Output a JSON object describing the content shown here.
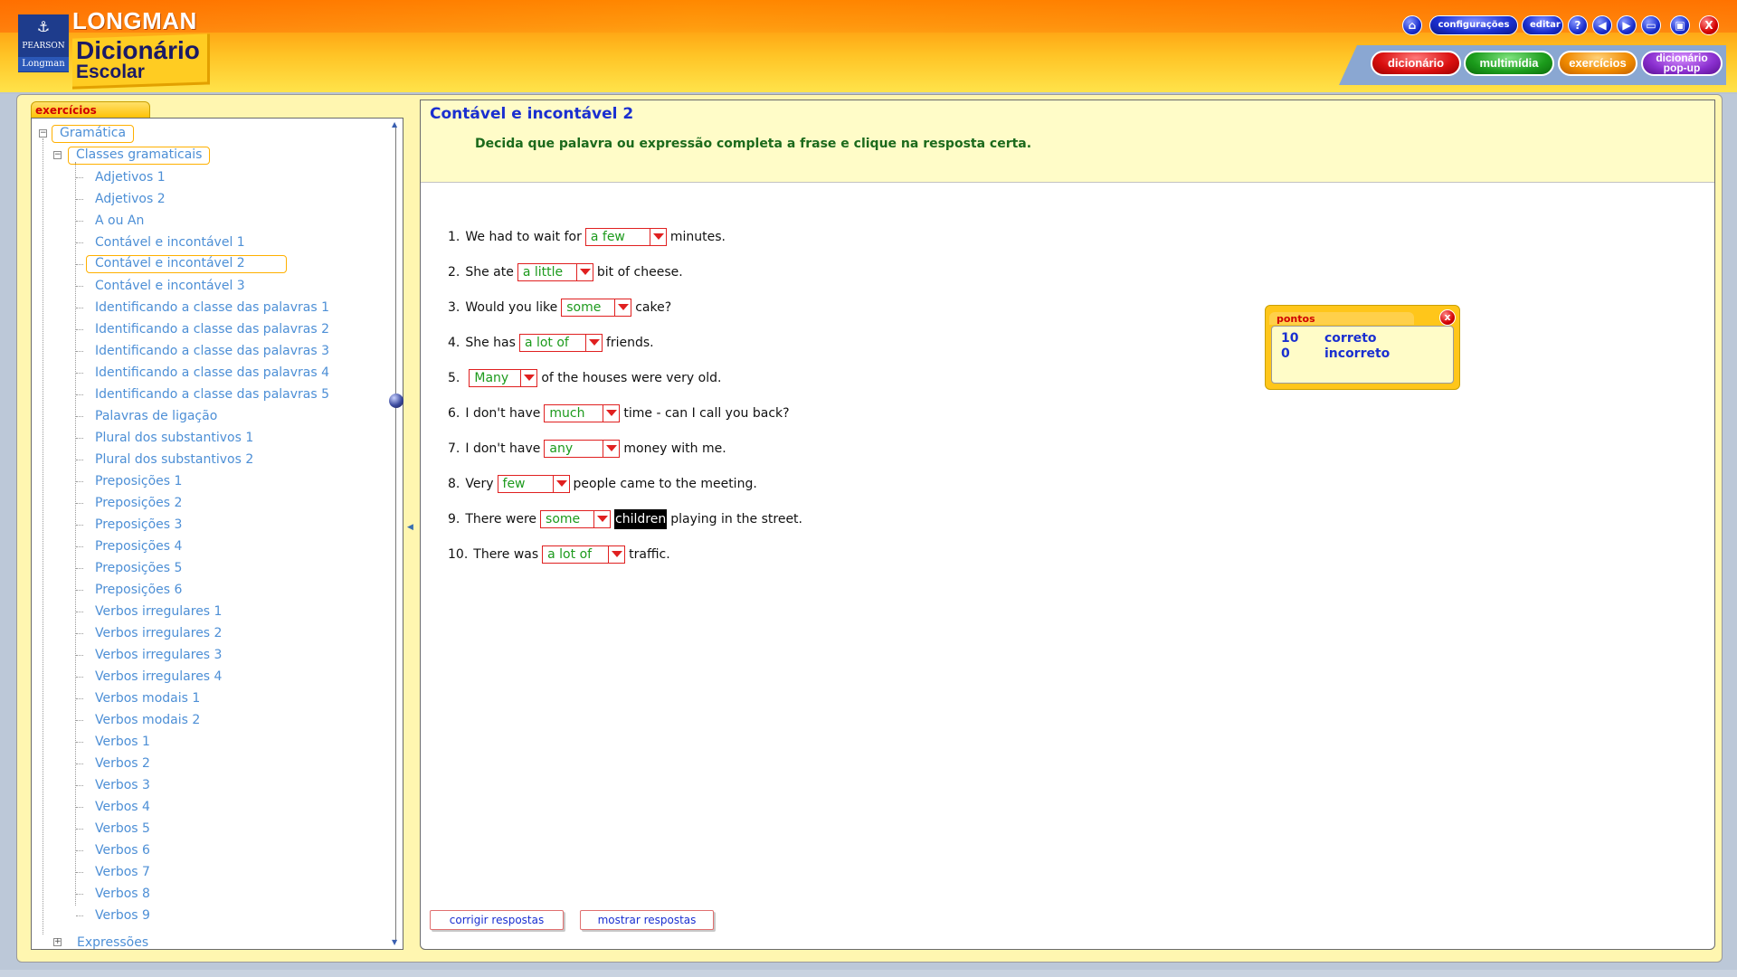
{
  "header": {
    "brand": "LONGMAN",
    "title_line1": "Dicionário",
    "title_line2": "Escolar",
    "publisher_top": "PEARSON",
    "publisher_bottom": "Longman"
  },
  "toolbar": {
    "home_icon": "home-icon",
    "settings_label": "configurações",
    "edit_label": "editar",
    "help_label": "?",
    "back_icon": "arrow-left-icon",
    "forward_icon": "arrow-right-icon",
    "restore_icon": "window-restore-icon",
    "maximize_icon": "window-maximize-icon",
    "close_label": "X"
  },
  "tabs": [
    {
      "label": "dicionário",
      "color": "#d90f0f"
    },
    {
      "label": "multimídia",
      "color": "#1c9c1c"
    },
    {
      "label": "exercícios",
      "color": "#f08a00"
    },
    {
      "label_line1": "dicionário",
      "label_line2": "pop-up",
      "color": "#8a2fcf"
    }
  ],
  "sidebar": {
    "tab_label": "exercícios",
    "root": "Gramática",
    "group": "Classes gramaticais",
    "items": [
      "Adjetivos 1",
      "Adjetivos 2",
      "A ou An",
      "Contável e incontável 1",
      "Contável e incontável 2",
      "Contável e incontável 3",
      "Identificando a classe das palavras 1",
      "Identificando a classe das palavras 2",
      "Identificando a classe das palavras 3",
      "Identificando a classe das palavras 4",
      "Identificando a classe das palavras 5",
      "Palavras de ligação",
      "Plural dos substantivos 1",
      "Plural dos substantivos 2",
      "Preposições 1",
      "Preposições 2",
      "Preposições 3",
      "Preposições 4",
      "Preposições 5",
      "Preposições 6",
      "Verbos irregulares 1",
      "Verbos irregulares 2",
      "Verbos irregulares 3",
      "Verbos irregulares 4",
      "Verbos modais 1",
      "Verbos modais 2",
      "Verbos 1",
      "Verbos 2",
      "Verbos 3",
      "Verbos 4",
      "Verbos 5",
      "Verbos 6",
      "Verbos 7",
      "Verbos 8",
      "Verbos 9"
    ],
    "selected_item": "Contável e incontável 2",
    "last_root": "Expressões"
  },
  "exercise": {
    "title": "Contável e incontável 2",
    "instructions": "Decida que palavra ou expressão completa a frase e clique na resposta certa.",
    "questions": [
      {
        "num": "1.",
        "before": "We had to wait for",
        "answer": "a few",
        "after": "minutes."
      },
      {
        "num": "2.",
        "before": "She ate",
        "answer": "a little",
        "after": "bit of cheese."
      },
      {
        "num": "3.",
        "before": "Would you like",
        "answer": "some",
        "after": "cake?"
      },
      {
        "num": "4.",
        "before": "She has",
        "answer": "a lot of",
        "after": "friends."
      },
      {
        "num": "5.",
        "before": "",
        "answer": "Many",
        "after": "of the houses were very old."
      },
      {
        "num": "6.",
        "before": "I don't have",
        "answer": "much",
        "after": "time - can I call you back?"
      },
      {
        "num": "7.",
        "before": "I don't have",
        "answer": "any",
        "after": "money with me."
      },
      {
        "num": "8.",
        "before": "Very",
        "answer": "few",
        "after": "people came to the meeting."
      },
      {
        "num": "9.",
        "before": "There were",
        "answer": "some",
        "highlight": "children",
        "after": "playing in the street."
      },
      {
        "num": "10.",
        "before": "There was",
        "answer": "a lot of",
        "after": "traffic."
      }
    ],
    "buttons": {
      "check": "corrigir respostas",
      "show": "mostrar respostas"
    }
  },
  "score": {
    "title": "pontos",
    "close_label": "x",
    "correct_count": "10",
    "correct_label": "correto",
    "incorrect_count": "0",
    "incorrect_label": "incorreto"
  }
}
